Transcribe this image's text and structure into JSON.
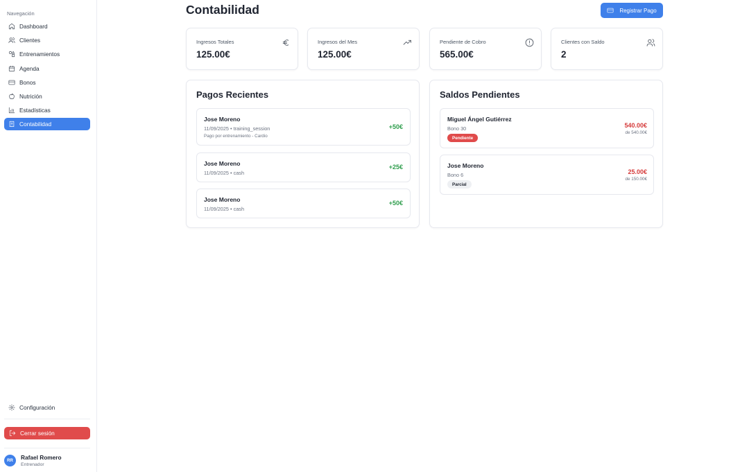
{
  "sidebar": {
    "heading": "Navegación",
    "items": [
      {
        "label": "Dashboard",
        "icon": "home-icon"
      },
      {
        "label": "Clientes",
        "icon": "users-icon"
      },
      {
        "label": "Entrenamientos",
        "icon": "shapes-icon"
      },
      {
        "label": "Agenda",
        "icon": "calendar-icon"
      },
      {
        "label": "Bonos",
        "icon": "credit-card-icon"
      },
      {
        "label": "Nutrición",
        "icon": "apple-icon"
      },
      {
        "label": "Estadísticas",
        "icon": "bar-chart-icon"
      },
      {
        "label": "Contabilidad",
        "icon": "receipt-icon",
        "active": true
      }
    ],
    "config_label": "Configuración",
    "logout_label": "Cerrar sesión",
    "user": {
      "initials": "RR",
      "name": "Rafael Romero",
      "role": "Entrenador"
    }
  },
  "header": {
    "title": "Contabilidad",
    "register_button": "Registrar Pago"
  },
  "stats": [
    {
      "label": "Ingresos Totales",
      "value": "125.00€",
      "icon": "euro-icon"
    },
    {
      "label": "Ingresos del Mes",
      "value": "125.00€",
      "icon": "trending-up-icon"
    },
    {
      "label": "Pendiente de Cobro",
      "value": "565.00€",
      "icon": "alert-circle-icon"
    },
    {
      "label": "Clientes con Saldo",
      "value": "2",
      "icon": "users-icon"
    }
  ],
  "recent_payments": {
    "title": "Pagos Recientes",
    "items": [
      {
        "name": "Jose Moreno",
        "sub": "11/09/2025 • training_session",
        "note": "Pago por entrenamiento - Cardio",
        "amount": "+50€"
      },
      {
        "name": "Jose Moreno",
        "sub": "11/09/2025 • cash",
        "amount": "+25€"
      },
      {
        "name": "Jose Moreno",
        "sub": "11/09/2025 • cash",
        "amount": "+50€"
      }
    ]
  },
  "pending_balances": {
    "title": "Saldos Pendientes",
    "items": [
      {
        "name": "Miguel Ángel Gutiérrez",
        "sub": "Bono 30",
        "badge": "Pendiente",
        "amount": "540.00€",
        "of": "de 540.00€"
      },
      {
        "name": "Jose Moreno",
        "sub": "Bono 6",
        "badge": "Parcial",
        "amount": "25.00€",
        "of": "de 150.00€"
      }
    ]
  },
  "colors": {
    "accent": "#3f80ea",
    "danger": "#e04b4b",
    "positive": "#2f9e4d"
  }
}
